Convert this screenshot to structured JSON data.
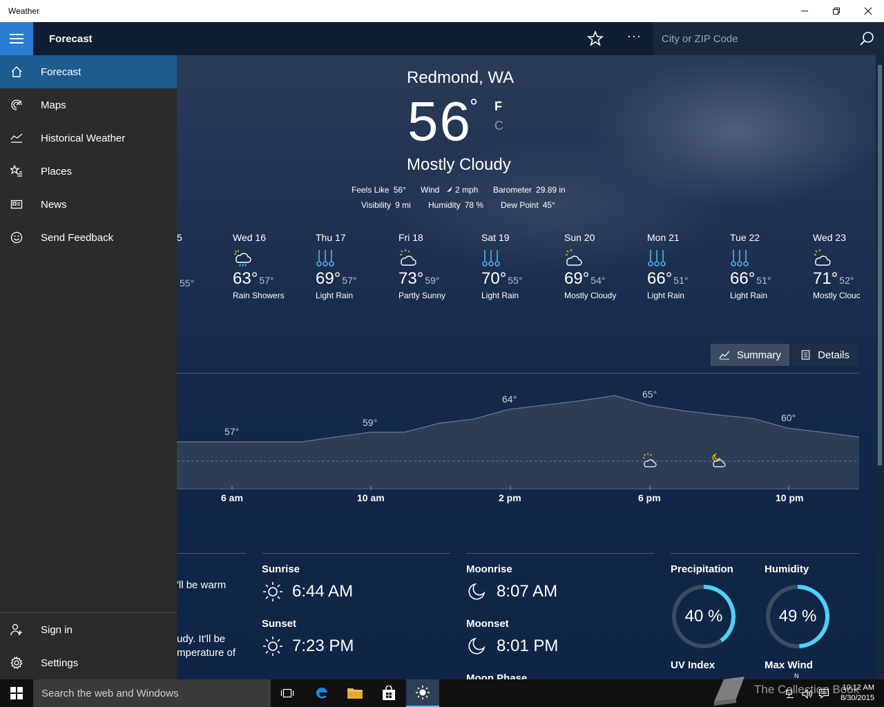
{
  "window": {
    "title": "Weather"
  },
  "appbar": {
    "page_title": "Forecast",
    "more_label": "···",
    "search_placeholder": "City or ZIP Code"
  },
  "nav": {
    "items": [
      {
        "label": "Forecast",
        "icon": "home-icon"
      },
      {
        "label": "Maps",
        "icon": "radar-icon"
      },
      {
        "label": "Historical Weather",
        "icon": "chart-icon"
      },
      {
        "label": "Places",
        "icon": "star-list-icon"
      },
      {
        "label": "News",
        "icon": "news-icon"
      },
      {
        "label": "Send Feedback",
        "icon": "smiley-icon"
      }
    ],
    "footer": [
      {
        "label": "Sign in",
        "icon": "user-add-icon"
      },
      {
        "label": "Settings",
        "icon": "gear-icon"
      }
    ]
  },
  "current": {
    "location": "Redmond, WA",
    "temperature": "56",
    "degree": "°",
    "unit_f": "F",
    "unit_c": "C",
    "condition": "Mostly Cloudy",
    "feels_like_label": "Feels Like",
    "feels_like": "56°",
    "wind_label": "Wind",
    "wind": "2 mph",
    "barometer_label": "Barometer",
    "barometer": "29.89 in",
    "visibility_label": "Visibility",
    "visibility": "9 mi",
    "humidity_label": "Humidity",
    "humidity": "78 %",
    "dew_point_label": "Dew Point",
    "dew_point": "45°"
  },
  "daily": {
    "partial_left": {
      "day": "5",
      "lo": "55°"
    },
    "days": [
      {
        "day": "Wed 16",
        "hi": "63°",
        "lo": "57°",
        "cond": "Rain Showers",
        "icon": "rain-showers-icon"
      },
      {
        "day": "Thu 17",
        "hi": "69°",
        "lo": "57°",
        "cond": "Light Rain",
        "icon": "light-rain-icon"
      },
      {
        "day": "Fri 18",
        "hi": "73°",
        "lo": "59°",
        "cond": "Partly Sunny",
        "icon": "partly-sunny-icon"
      },
      {
        "day": "Sat 19",
        "hi": "70°",
        "lo": "55°",
        "cond": "Light Rain",
        "icon": "light-rain-icon"
      },
      {
        "day": "Sun 20",
        "hi": "69°",
        "lo": "54°",
        "cond": "Mostly Cloudy",
        "icon": "mostly-cloudy-icon"
      },
      {
        "day": "Mon 21",
        "hi": "66°",
        "lo": "51°",
        "cond": "Light Rain",
        "icon": "light-rain-icon"
      },
      {
        "day": "Tue 22",
        "hi": "66°",
        "lo": "51°",
        "cond": "Light Rain",
        "icon": "light-rain-icon"
      },
      {
        "day": "Wed 23",
        "hi": "71°",
        "lo": "52°",
        "cond": "Mostly Clouc",
        "icon": "mostly-cloudy-icon"
      }
    ]
  },
  "view_toggle": {
    "summary": "Summary",
    "details": "Details",
    "selected": "Summary"
  },
  "hourly": {
    "temp_labels": [
      "57°",
      "59°",
      "64°",
      "65°",
      "60°"
    ],
    "ticks": [
      "6 am",
      "10 am",
      "2 pm",
      "6 pm",
      "10 pm"
    ]
  },
  "details": {
    "text_fragments": [
      "'ll be warm",
      "udy. It'll be",
      "mperature of"
    ],
    "sunrise_label": "Sunrise",
    "sunrise": "6:44 AM",
    "sunset_label": "Sunset",
    "sunset": "7:23 PM",
    "moonrise_label": "Moonrise",
    "moonrise": "8:07 AM",
    "moonset_label": "Moonset",
    "moonset": "8:01 PM",
    "moon_phase_label": "Moon Phase",
    "precipitation_label": "Precipitation",
    "precipitation": "40 %",
    "precipitation_fraction": 0.4,
    "humidity_label": "Humidity",
    "humidity": "49 %",
    "humidity_fraction": 0.49,
    "uv_label": "UV Index",
    "max_wind_label": "Max Wind",
    "max_wind_dir": "N"
  },
  "taskbar": {
    "search": "Search the web and Windows",
    "time": "10:12 AM",
    "date": "8/30/2015",
    "watermark": "The Collection Book"
  },
  "colors": {
    "accent": "#2b7cd3",
    "ring": "#4fd0f5",
    "nav_active": "#1e5b8f"
  }
}
